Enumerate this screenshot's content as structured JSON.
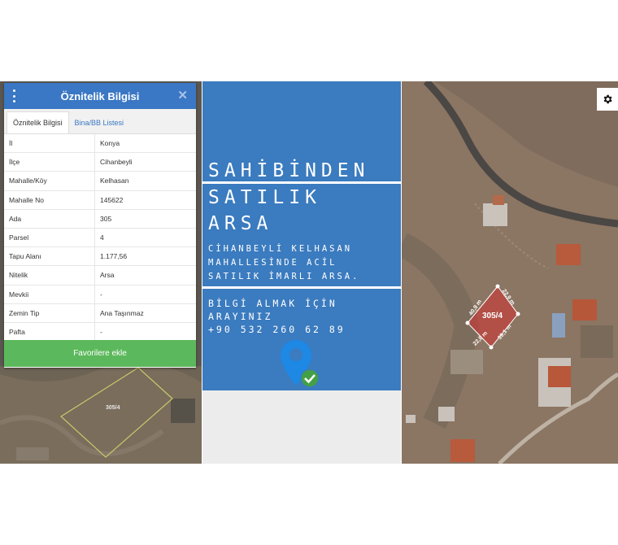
{
  "attribute_panel": {
    "title": "Öznitelik Bilgisi",
    "tabs": [
      {
        "label": "Öznitelik Bilgisi",
        "active": true
      },
      {
        "label": "Bina/BB Listesi",
        "active": false
      }
    ],
    "rows": [
      {
        "key": "İl",
        "value": "Konya"
      },
      {
        "key": "İlçe",
        "value": "Cihanbeyli"
      },
      {
        "key": "Mahalle/Köy",
        "value": "Kelhasan"
      },
      {
        "key": "Mahalle No",
        "value": "145622"
      },
      {
        "key": "Ada",
        "value": "305"
      },
      {
        "key": "Parsel",
        "value": "4"
      },
      {
        "key": "Tapu Alanı",
        "value": "1.177,56"
      },
      {
        "key": "Nitelik",
        "value": "Arsa"
      },
      {
        "key": "Mevkii",
        "value": "-"
      },
      {
        "key": "Zemin Tip",
        "value": "Ana Taşınmaz"
      },
      {
        "key": "Pafta",
        "value": "-"
      }
    ],
    "favorite_button": "Favorilere ekle",
    "map_parcel_label": "305/4"
  },
  "ad": {
    "title_lines": [
      "SAHİBİNDEN",
      "SATILIK",
      "ARSA"
    ],
    "description_lines": [
      "CİHANBEYLİ KELHASAN",
      "MAHALLESİNDE ACİL",
      "SATILIK İMARLI ARSA."
    ],
    "contact_lines": [
      "BİLGİ ALMAK İÇİN",
      "ARAYINIZ"
    ],
    "phone": "+90 532 260 62 89",
    "icon": "location-pin-check-icon",
    "colors": {
      "background": "#3b7bbf",
      "pin": "#1e88e5",
      "check": "#43a047"
    }
  },
  "satellite_map": {
    "parcel_label": "305/4",
    "edge_labels": [
      "22,9 m",
      "40,9 m",
      "22,8 m",
      "39,1 m"
    ],
    "settings_icon": "gear-icon",
    "colors": {
      "parcel": "#d32f2f"
    }
  }
}
